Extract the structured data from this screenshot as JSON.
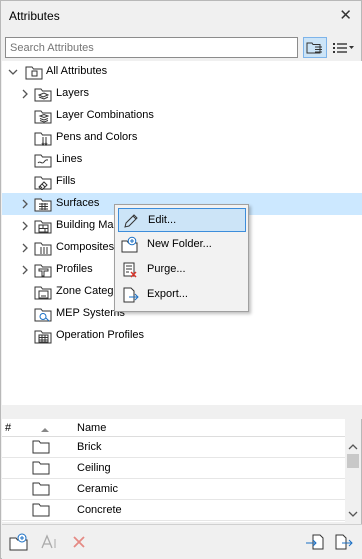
{
  "window": {
    "title": "Attributes"
  },
  "search": {
    "placeholder": "Search Attributes"
  },
  "tree": {
    "root_label": "All Attributes",
    "items": [
      {
        "label": "Layers"
      },
      {
        "label": "Layer Combinations"
      },
      {
        "label": "Pens and Colors"
      },
      {
        "label": "Lines"
      },
      {
        "label": "Fills"
      },
      {
        "label": "Surfaces"
      },
      {
        "label": "Building Ma"
      },
      {
        "label": "Composites"
      },
      {
        "label": "Profiles"
      },
      {
        "label": "Zone Categ"
      },
      {
        "label": "MEP Systems"
      },
      {
        "label": "Operation Profiles"
      }
    ]
  },
  "context_menu": {
    "items": [
      {
        "label": "Edit...",
        "icon": "pencil-icon"
      },
      {
        "label": "New Folder...",
        "icon": "new-folder-icon"
      },
      {
        "label": "Purge...",
        "icon": "purge-icon"
      },
      {
        "label": "Export...",
        "icon": "export-icon"
      }
    ]
  },
  "list": {
    "columns": {
      "index": "#",
      "name": "Name"
    },
    "rows": [
      {
        "name": "Brick"
      },
      {
        "name": "Ceiling"
      },
      {
        "name": "Ceramic"
      },
      {
        "name": "Concrete"
      }
    ]
  },
  "colors": {
    "selection": "#cce8ff",
    "menu_highlight": "#cce4f7",
    "accent": "#3c8ddb"
  }
}
